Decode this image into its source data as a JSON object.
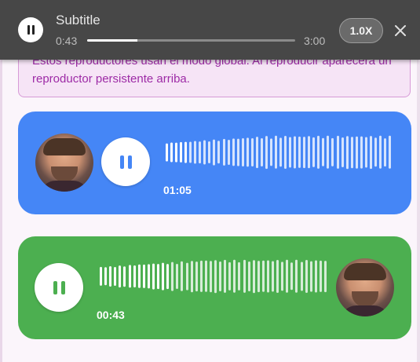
{
  "info_box": {
    "text": "Estos reproductores usan el modo global. Al reproducir aparecerá un reproductor persistente arriba."
  },
  "mini_player": {
    "title": "Subtitle",
    "current_time": "0:43",
    "total_time": "3:00",
    "progress": 0.24,
    "speed": "1.0X",
    "icons": {
      "play": "pause-icon",
      "close": "close-icon"
    }
  },
  "cards": [
    {
      "color": "#4586f6",
      "time": "01:05",
      "progress": 0.1,
      "avatar_side": "left",
      "play_icon": "pause-icon"
    },
    {
      "color": "#4caf50",
      "time": "00:43",
      "progress": 0.31,
      "avatar_side": "right",
      "play_icon": "pause-icon"
    }
  ],
  "colors": {
    "mini_player_bg": "#474747",
    "info_text": "#9d2ba6",
    "info_border": "#d79ad7",
    "page_bg": "#fbf5fb"
  }
}
